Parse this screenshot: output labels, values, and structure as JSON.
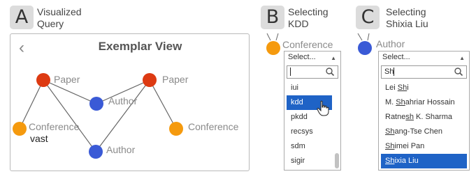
{
  "panel_a": {
    "badge": "A",
    "title_lines": [
      "Visualized",
      "Query"
    ],
    "view_title": "Exemplar View",
    "nodes": [
      {
        "id": "paper1",
        "label": "Paper",
        "color": "#dd3a12"
      },
      {
        "id": "paper2",
        "label": "Paper",
        "color": "#dd3a12"
      },
      {
        "id": "author1",
        "label": "Author",
        "color": "#3a5ad6"
      },
      {
        "id": "author2",
        "label": "Author",
        "color": "#3a5ad6"
      },
      {
        "id": "conf1",
        "label": "Conference",
        "sublabel": "vast",
        "color": "#f59a0e"
      },
      {
        "id": "conf2",
        "label": "Conference",
        "color": "#f59a0e"
      }
    ],
    "edges": [
      [
        "paper1",
        "conf1"
      ],
      [
        "paper1",
        "author1"
      ],
      [
        "paper1",
        "author2"
      ],
      [
        "paper2",
        "author1"
      ],
      [
        "paper2",
        "author2"
      ],
      [
        "paper2",
        "conf2"
      ]
    ]
  },
  "panel_b": {
    "badge": "B",
    "title_lines": [
      "Selecting",
      "KDD"
    ],
    "node_label": "Conference",
    "node_color": "#f59a0e",
    "select_placeholder": "Select...",
    "search_value": "",
    "options": [
      {
        "text": "iui",
        "selected": false
      },
      {
        "text": "kdd",
        "selected": true
      },
      {
        "text": "pkdd",
        "selected": false
      },
      {
        "text": "recsys",
        "selected": false
      },
      {
        "text": "sdm",
        "selected": false
      },
      {
        "text": "sigir",
        "selected": false
      }
    ]
  },
  "panel_c": {
    "badge": "C",
    "title_lines": [
      "Selecting",
      "Shixia Liu"
    ],
    "node_label": "Author",
    "node_color": "#3a5ad6",
    "select_placeholder": "Select...",
    "search_value": "Sh",
    "options": [
      {
        "pre": "Lei ",
        "match": "Sh",
        "post": "i",
        "selected": false
      },
      {
        "pre": "M. ",
        "match": "Sh",
        "post": "ahriar Hossain",
        "selected": false
      },
      {
        "pre": "Ratne",
        "match": "sh",
        "post": " K. Sharma",
        "selected": false
      },
      {
        "pre": "",
        "match": "Sh",
        "post": "ang-Tse Chen",
        "selected": false
      },
      {
        "pre": "",
        "match": "Sh",
        "post": "imei Pan",
        "selected": false
      },
      {
        "pre": "",
        "match": "Sh",
        "post": "ixia Liu",
        "selected": true
      }
    ]
  }
}
